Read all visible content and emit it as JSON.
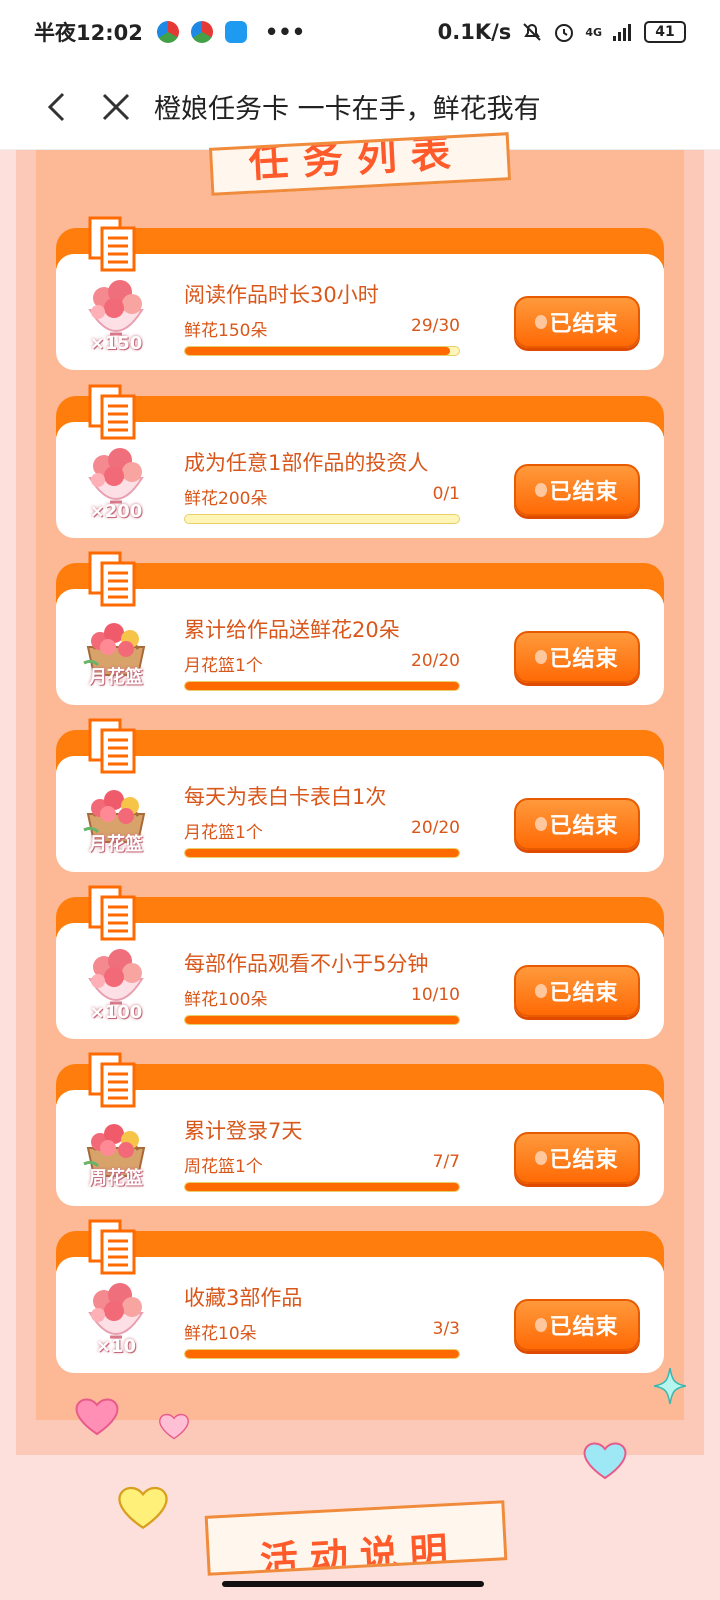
{
  "status_bar": {
    "time": "半夜12:02",
    "net_speed": "0.1K/s",
    "network": "4G",
    "battery": "41"
  },
  "nav": {
    "title": "橙娘任务卡 一卡在手，鲜花我有"
  },
  "section_banner": "任务列表",
  "tasks": [
    {
      "title": "阅读作品时长30小时",
      "reward_text": "鲜花150朵",
      "progress_text": "29/30",
      "progress": 0.967,
      "reward_label": "×150",
      "reward_icon": "flower-bouquet-icon",
      "status_label": "已结束"
    },
    {
      "title": "成为任意1部作品的投资人",
      "reward_text": "鲜花200朵",
      "progress_text": "0/1",
      "progress": 0,
      "reward_label": "×200",
      "reward_icon": "flower-bouquet-icon",
      "status_label": "已结束"
    },
    {
      "title": "累计给作品送鲜花20朵",
      "reward_text": "月花篮1个",
      "progress_text": "20/20",
      "progress": 1,
      "reward_label": "月花篮",
      "reward_icon": "flower-basket-icon",
      "status_label": "已结束"
    },
    {
      "title": "每天为表白卡表白1次",
      "reward_text": "月花篮1个",
      "progress_text": "20/20",
      "progress": 1,
      "reward_label": "月花篮",
      "reward_icon": "flower-basket-icon",
      "status_label": "已结束"
    },
    {
      "title": "每部作品观看不小于5分钟",
      "reward_text": "鲜花100朵",
      "progress_text": "10/10",
      "progress": 1,
      "reward_label": "×100",
      "reward_icon": "flower-bouquet-icon",
      "status_label": "已结束"
    },
    {
      "title": "累计登录7天",
      "reward_text": "周花篮1个",
      "progress_text": "7/7",
      "progress": 1,
      "reward_label": "周花篮",
      "reward_icon": "flower-basket-icon",
      "status_label": "已结束"
    },
    {
      "title": "收藏3部作品",
      "reward_text": "鲜花10朵",
      "progress_text": "3/3",
      "progress": 1,
      "reward_label": "×10",
      "reward_icon": "flower-bouquet-icon",
      "status_label": "已结束"
    }
  ],
  "bottom_banner": "活动说明",
  "colors": {
    "accent": "#ff7d0c",
    "text": "#d9571a",
    "panel": "#fdb996",
    "page_bg": "#fde0dc"
  }
}
